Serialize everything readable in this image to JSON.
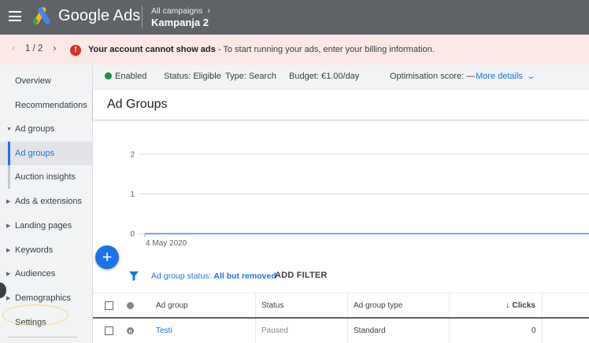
{
  "header": {
    "product_name": "Google Ads",
    "breadcrumb_parent": "All campaigns",
    "breadcrumb_current": "Kampanja 2",
    "icons": [
      "menu-icon",
      "google-ads-logo",
      "chevron-right-icon"
    ]
  },
  "alert": {
    "pager": "1 / 2",
    "title": "Your account cannot show ads",
    "message": " - To start running your ads, enter your billing information.",
    "icon": "error-icon",
    "color": "#d93025"
  },
  "sidebar": {
    "items": [
      {
        "label": "Overview"
      },
      {
        "label": "Recommendations"
      },
      {
        "label": "Ad groups"
      },
      {
        "label": "Ad groups"
      },
      {
        "label": "Auction insights"
      },
      {
        "label": "Ads & extensions"
      },
      {
        "label": "Landing pages"
      },
      {
        "label": "Keywords"
      },
      {
        "label": "Audiences"
      },
      {
        "label": "Demographics"
      },
      {
        "label": "Settings"
      }
    ]
  },
  "status": {
    "enabled": "Enabled",
    "status_label": "Status:",
    "status_value": "Eligible",
    "type_label": "Type:",
    "type_value": "Search",
    "budget_label": "Budget:",
    "budget_value": "€1.00/day",
    "optimisation_label": "Optimisation score:",
    "optimisation_value": "—",
    "more_details": "More details"
  },
  "page": {
    "title": "Ad Groups"
  },
  "chart_data": {
    "type": "line",
    "x": [
      "4 May 2020"
    ],
    "series": [
      {
        "values": [
          0
        ]
      }
    ],
    "yticks": [
      0,
      1,
      2
    ],
    "xtick_labels": [
      "4 May 2020"
    ],
    "ylim": [
      0,
      2
    ],
    "grid": true,
    "line_color": "#4285f4"
  },
  "filter": {
    "chip_label": "Ad group status:",
    "chip_value": "All but removed",
    "add_filter": "ADD FILTER"
  },
  "table": {
    "columns": [
      "Ad group",
      "Status",
      "Ad group type",
      "Clicks"
    ],
    "rows": [
      {
        "ad_group": "Testi",
        "status": "Paused",
        "type": "Standard",
        "clicks": "0"
      }
    ]
  }
}
